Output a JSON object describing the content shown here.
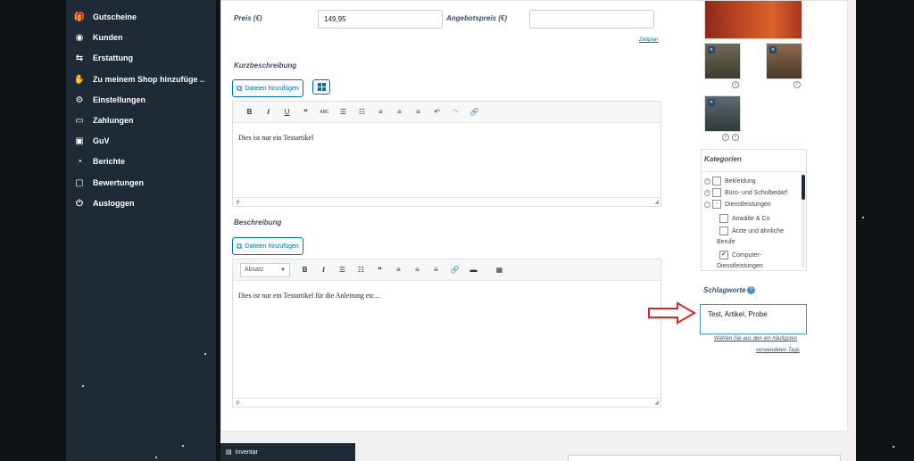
{
  "sidebar": {
    "items": [
      {
        "label": "Gutscheine",
        "icon": "gift-icon",
        "glyph": "🎁"
      },
      {
        "label": "Kunden",
        "icon": "user-circle-icon",
        "glyph": "◉"
      },
      {
        "label": "Erstattung",
        "icon": "refund-arrows-icon",
        "glyph": "⇆"
      },
      {
        "label": "Zu meinem Shop hinzufüge ..",
        "icon": "hand-icon",
        "glyph": "✋"
      },
      {
        "label": "Einstellungen",
        "icon": "gears-icon",
        "glyph": "⚙"
      },
      {
        "label": "Zahlungen",
        "icon": "credit-card-icon",
        "glyph": "▭"
      },
      {
        "label": "GuV",
        "icon": "money-icon",
        "glyph": "▣"
      },
      {
        "label": "Berichte",
        "icon": "pie-chart-icon",
        "glyph": "◔"
      },
      {
        "label": "Bewertungen",
        "icon": "comment-icon",
        "glyph": "▢"
      },
      {
        "label": "Ausloggen",
        "icon": "power-icon",
        "glyph": "⏻"
      }
    ]
  },
  "pricing": {
    "price_label": "Preis (€)",
    "price_value": "149,95",
    "sale_label": "Angebotspreis (€)",
    "sale_value": "",
    "schedule_link": "Zeitplan"
  },
  "short_description": {
    "title": "Kurzbeschreibung",
    "add_files": "Dateien hinzufügen",
    "content": "Dies ist nur ein Testartikel",
    "status": "p"
  },
  "description": {
    "title": "Beschreibung",
    "add_files": "Dateien hinzufügen",
    "format_select": "Absatz",
    "content": "Dies ist nur ein Testartikel für die Anleitung etc...",
    "status": "p"
  },
  "categories": {
    "title": "Kategorien",
    "items": [
      {
        "label": "Bekleidung",
        "checked": false
      },
      {
        "label": "Büro- und Schulbedarf",
        "checked": false
      },
      {
        "label": "Dienstleistungen",
        "checked": false
      },
      {
        "label": "Anwälte & Co",
        "checked": false
      },
      {
        "label": "Ärzte und ähnliche",
        "checked": false
      },
      {
        "label": "Berufe",
        "checked": false
      },
      {
        "label": "Computer-",
        "checked": true
      },
      {
        "label": "Dienstleistungen",
        "checked": false
      }
    ]
  },
  "tags": {
    "title": "Schlagworte",
    "value": "Test, Artikel, Probe",
    "help_line1": "Wählen Sie aus den am häufigsten",
    "help_line2": "verwendeten Tags"
  },
  "bottom": {
    "inventory_label": "Inventar"
  },
  "colors": {
    "sidebar_bg": "#1e2a35",
    "accent": "#0073aa",
    "arrow": "#d9232a"
  }
}
